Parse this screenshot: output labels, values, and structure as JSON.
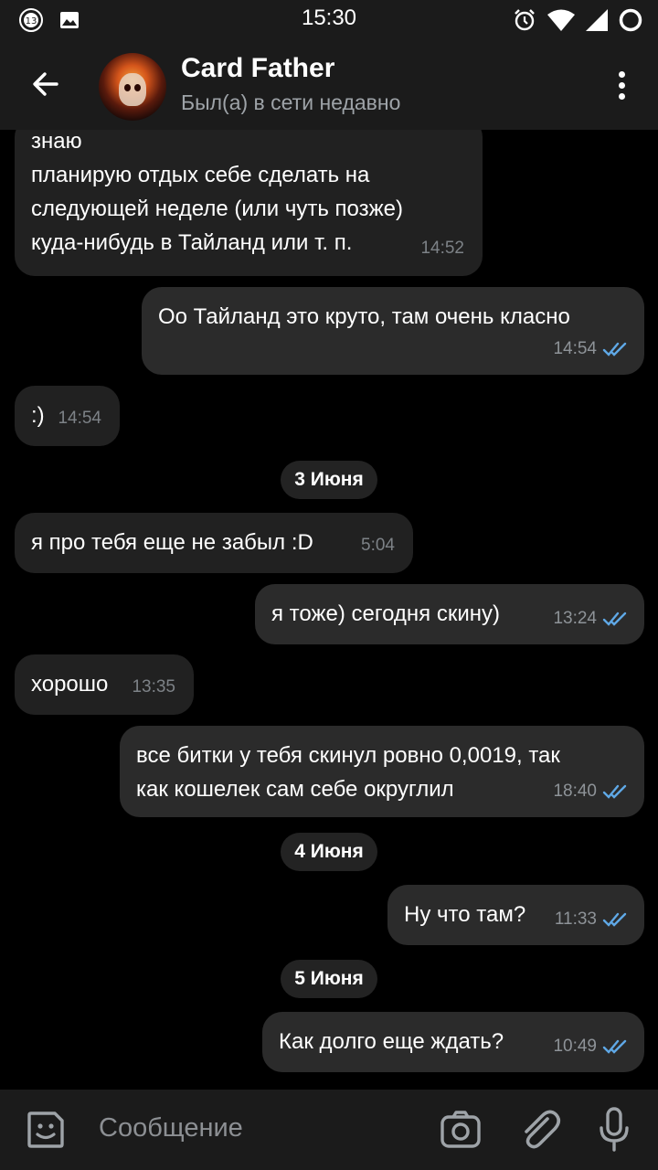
{
  "status_bar": {
    "time": "15:30",
    "notification_badge": "13"
  },
  "header": {
    "name": "Card Father",
    "status": "Был(а) в сети недавно"
  },
  "messages": [
    {
      "direction": "in",
      "text": "знаю\nпланирую отдых себе сделать на\nследующей неделе (или чуть позже)\nкуда-нибудь в Тайланд или т. п.",
      "time": "14:52"
    },
    {
      "direction": "out",
      "text": "Оо Тайланд это круто, там очень класно",
      "time": "14:54",
      "read": true
    },
    {
      "direction": "in",
      "text": ":)",
      "time": "14:54"
    },
    {
      "type": "date",
      "text": "3 Июня"
    },
    {
      "direction": "in",
      "text": "я про тебя еще не забыл :D",
      "time": "5:04"
    },
    {
      "direction": "out",
      "text": "я тоже) сегодня скину)",
      "time": "13:24",
      "read": true
    },
    {
      "direction": "in",
      "text": "хорошо",
      "time": "13:35"
    },
    {
      "direction": "out",
      "text": "все битки у тебя скинул ровно 0,0019, так\nкак кошелек сам себе округлил",
      "time": "18:40",
      "read": true
    },
    {
      "type": "date",
      "text": "4 Июня"
    },
    {
      "direction": "out",
      "text": "Ну что там?",
      "time": "11:33",
      "read": true
    },
    {
      "type": "date",
      "text": "5 Июня"
    },
    {
      "direction": "out",
      "text": "Как долго еще ждать?",
      "time": "10:49",
      "read": true
    }
  ],
  "composer": {
    "placeholder": "Сообщение"
  },
  "colors": {
    "bar_bg": "#1b1b1b",
    "chat_bg": "#000000",
    "bubble_in": "#212121",
    "bubble_out": "#2b2b2b",
    "read_check": "#5fa8e6",
    "muted_text": "#8e9398"
  },
  "icons": [
    "back-arrow-icon",
    "more-vertical-icon",
    "emoji-icon",
    "camera-icon",
    "attach-icon",
    "mic-icon",
    "alarm-icon",
    "wifi-icon",
    "signal-icon",
    "image-icon"
  ]
}
